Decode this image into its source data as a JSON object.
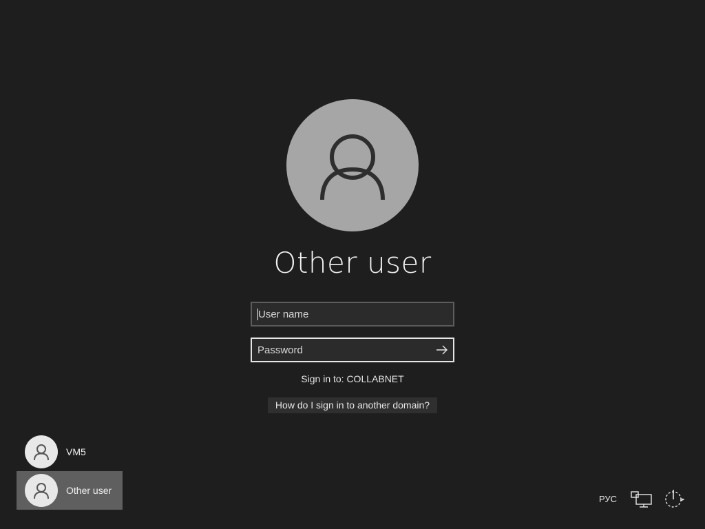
{
  "user": {
    "display_name": "Other user",
    "avatar_icon": "person-icon",
    "avatar_color": "#a6a6a6"
  },
  "form": {
    "username_placeholder": "User name",
    "password_placeholder": "Password",
    "submit_icon": "arrow-right-icon",
    "sign_in_to": "Sign in to: COLLABNET",
    "domain_help_link": "How do I sign in to another domain?"
  },
  "user_list": {
    "items": [
      {
        "label": "VM5",
        "icon": "person-icon",
        "selected": false
      },
      {
        "label": "Other user",
        "icon": "person-icon",
        "selected": true
      }
    ]
  },
  "tray": {
    "language": "РУС",
    "network_icon": "network-icon",
    "power_icon": "power-icon"
  },
  "colors": {
    "background": "#1e1e1e",
    "selected_item": "#5f5f5f",
    "field_background": "#2b2b2b"
  }
}
